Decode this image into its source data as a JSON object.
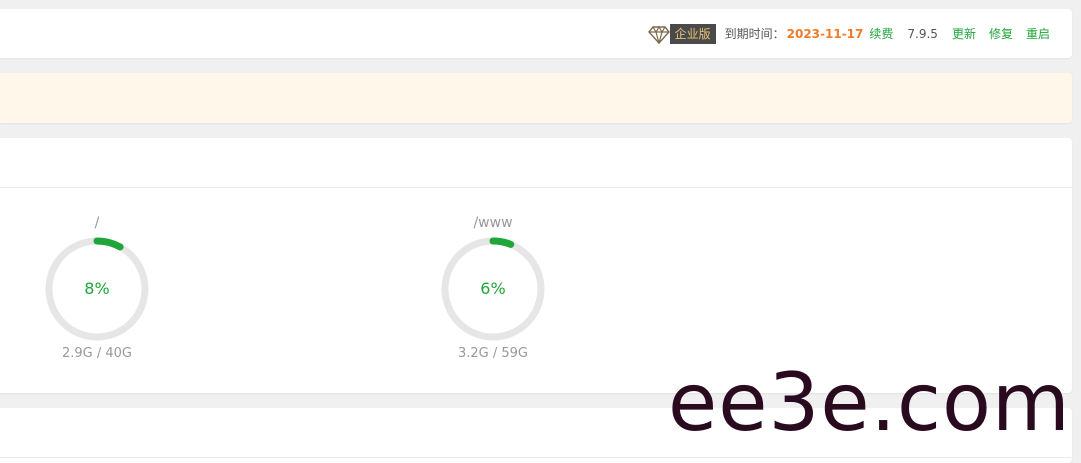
{
  "header": {
    "edition_badge": "企业版",
    "expire_label": "到期时间：",
    "expire_date": "2023-11-17",
    "renew": "续费",
    "version": "7.9.5",
    "actions": [
      "更新",
      "修复",
      "重启"
    ]
  },
  "disks": [
    {
      "path": "/",
      "percent_text": "8%",
      "percent": 8,
      "usage": "2.9G / 40G"
    },
    {
      "path": "/www",
      "percent_text": "6%",
      "percent": 6,
      "usage": "3.2G / 59G"
    }
  ],
  "colors": {
    "accent": "#20a53a",
    "expire": "#f07b2a",
    "gauge_track": "#e6e6e6",
    "notice_bg": "#fff8ea"
  },
  "watermark": "ee3e.com"
}
